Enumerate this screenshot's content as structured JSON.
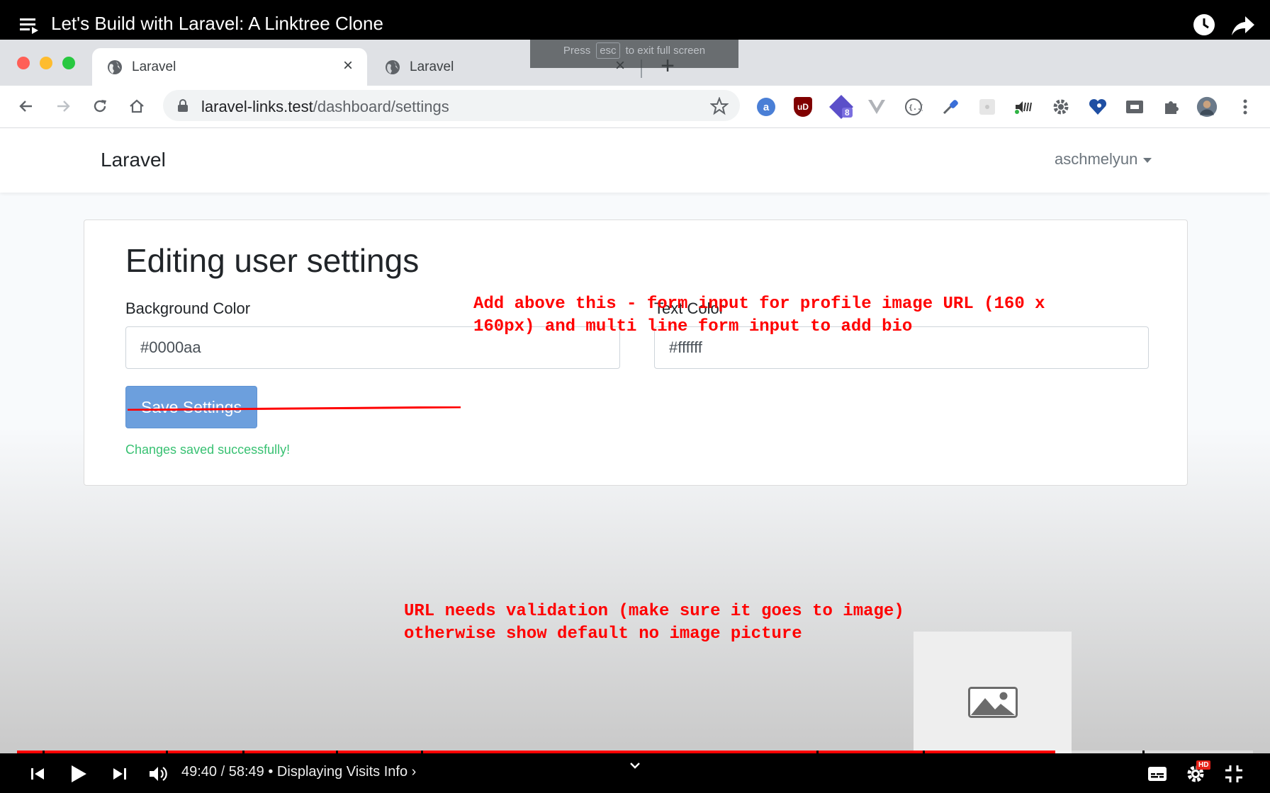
{
  "youtube": {
    "video_title": "Let's Build with Laravel: A Linktree Clone",
    "current_time": "49:40",
    "duration": "58:49",
    "time_separator": "/",
    "chapter": "• Displaying Visits Info",
    "chapter_chevron": "›",
    "progress_fraction": 0.84,
    "hd_badge": "HD"
  },
  "browser": {
    "tabs": [
      {
        "label": "Laravel",
        "active": true
      },
      {
        "label": "Laravel",
        "active": false
      }
    ],
    "url_host": "laravel-links.test",
    "url_path": "/dashboard/settings",
    "fullscreen_hint": {
      "before": "Press",
      "key": "esc",
      "after": "to exit full screen"
    },
    "extensions": [
      "a",
      "uD",
      "8"
    ]
  },
  "app": {
    "brand": "Laravel",
    "user": "aschmelyun"
  },
  "settings": {
    "title": "Editing user settings",
    "background_label": "Background Color",
    "background_value": "#0000aa",
    "text_label": "Text Color",
    "text_value": "#ffffff",
    "save_label": "Save Settings",
    "success": "Changes saved successfully!"
  },
  "annotations": {
    "top_line1": "Add above this - form input for profile image URL (160 x",
    "top_line2": "160px) and multi line form input to add bio",
    "bottom_line1": "URL needs validation (make sure it goes to image)",
    "bottom_line2": "otherwise show default no image picture"
  },
  "colors": {
    "annotation": "#ff0000",
    "progress": "#ff0000",
    "save_button": "#6c9fdd",
    "success": "#38c172"
  }
}
